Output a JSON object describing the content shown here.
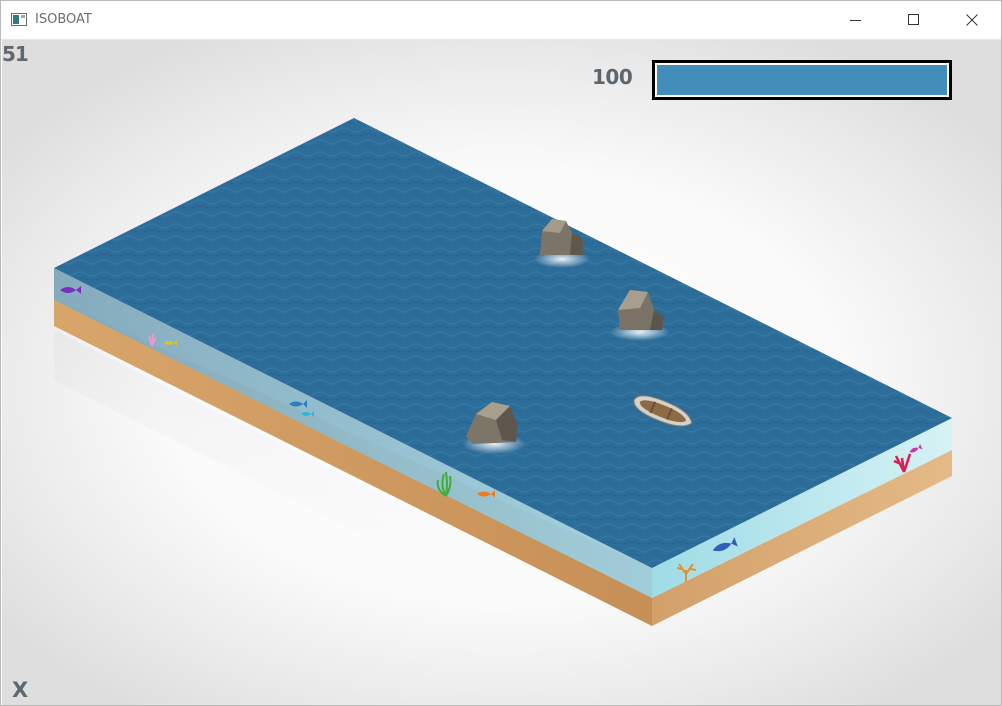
{
  "window": {
    "title": "ISOBOAT",
    "minimize_icon": "minimize-icon",
    "maximize_icon": "maximize-icon",
    "close_icon": "close-icon"
  },
  "hud": {
    "fps": "51",
    "score": "100",
    "health_fraction": 1.0,
    "health_color": "#428dba",
    "bottom_left_label": "X"
  },
  "scene": {
    "water_color": "#2b6c97",
    "sand_color": "#d9a66b",
    "glass_color": "#bfe8ee",
    "rocks": [
      "rock-icon",
      "rock-icon",
      "rock-icon"
    ],
    "boat": "rowboat-icon",
    "sea_life": [
      "fish-icon",
      "coral-icon",
      "fish-icon",
      "fish-icon",
      "seaweed-icon",
      "fish-icon",
      "coral-icon",
      "fish-icon",
      "coral-icon",
      "fish-icon"
    ]
  }
}
